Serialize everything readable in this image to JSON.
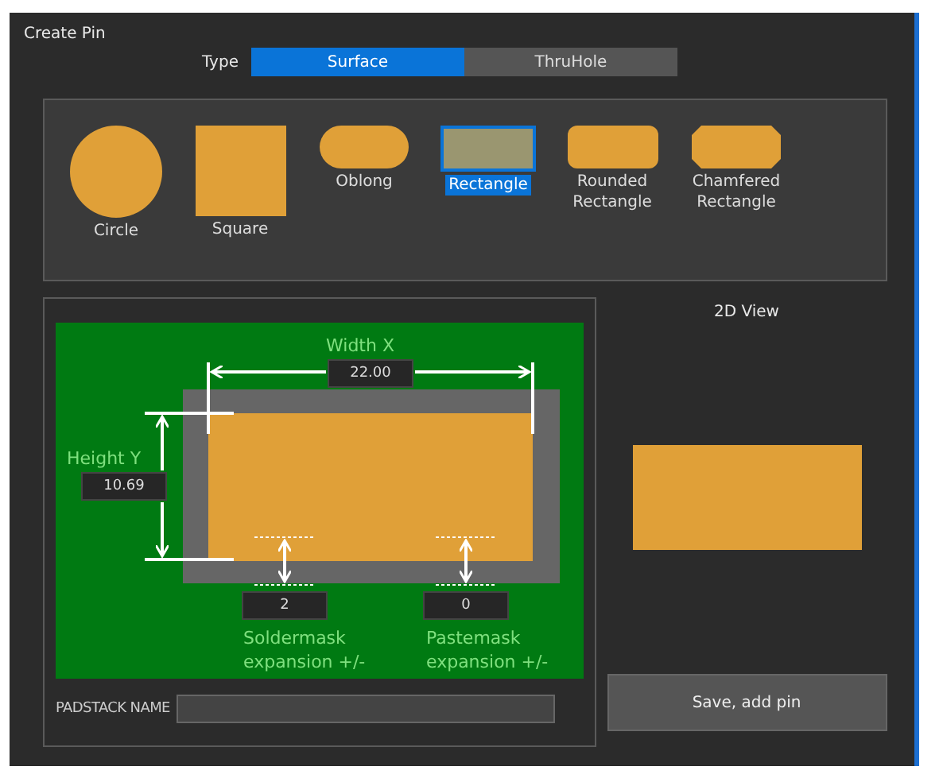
{
  "window": {
    "title": "Create Pin"
  },
  "type_selector": {
    "label": "Type",
    "options": [
      {
        "label": "Surface",
        "selected": true
      },
      {
        "label": "ThruHole",
        "selected": false
      }
    ]
  },
  "shapes": [
    {
      "label": "Circle",
      "kind": "circle",
      "selected": false
    },
    {
      "label": "Square",
      "kind": "square",
      "selected": false
    },
    {
      "label": "Oblong",
      "kind": "oblong",
      "selected": false
    },
    {
      "label": "Rectangle",
      "kind": "rectangle",
      "selected": true
    },
    {
      "label": "Rounded Rectangle",
      "kind": "rounded",
      "selected": false
    },
    {
      "label": "Chamfered Rectangle",
      "kind": "chamfered",
      "selected": false
    }
  ],
  "pad_editor": {
    "width": {
      "label": "Width X",
      "value": "22.00"
    },
    "height": {
      "label": "Height Y",
      "value": "10.69"
    },
    "soldermask": {
      "label": "Soldermask expansion +/-",
      "value": "2"
    },
    "pastemask": {
      "label": "Pastemask expansion +/-",
      "value": "0"
    }
  },
  "padstack_name": {
    "label": "PADSTACK NAME"
  },
  "preview": {
    "title": "2D View"
  },
  "buttons": [
    {
      "label": "Save, add pin"
    }
  ]
}
